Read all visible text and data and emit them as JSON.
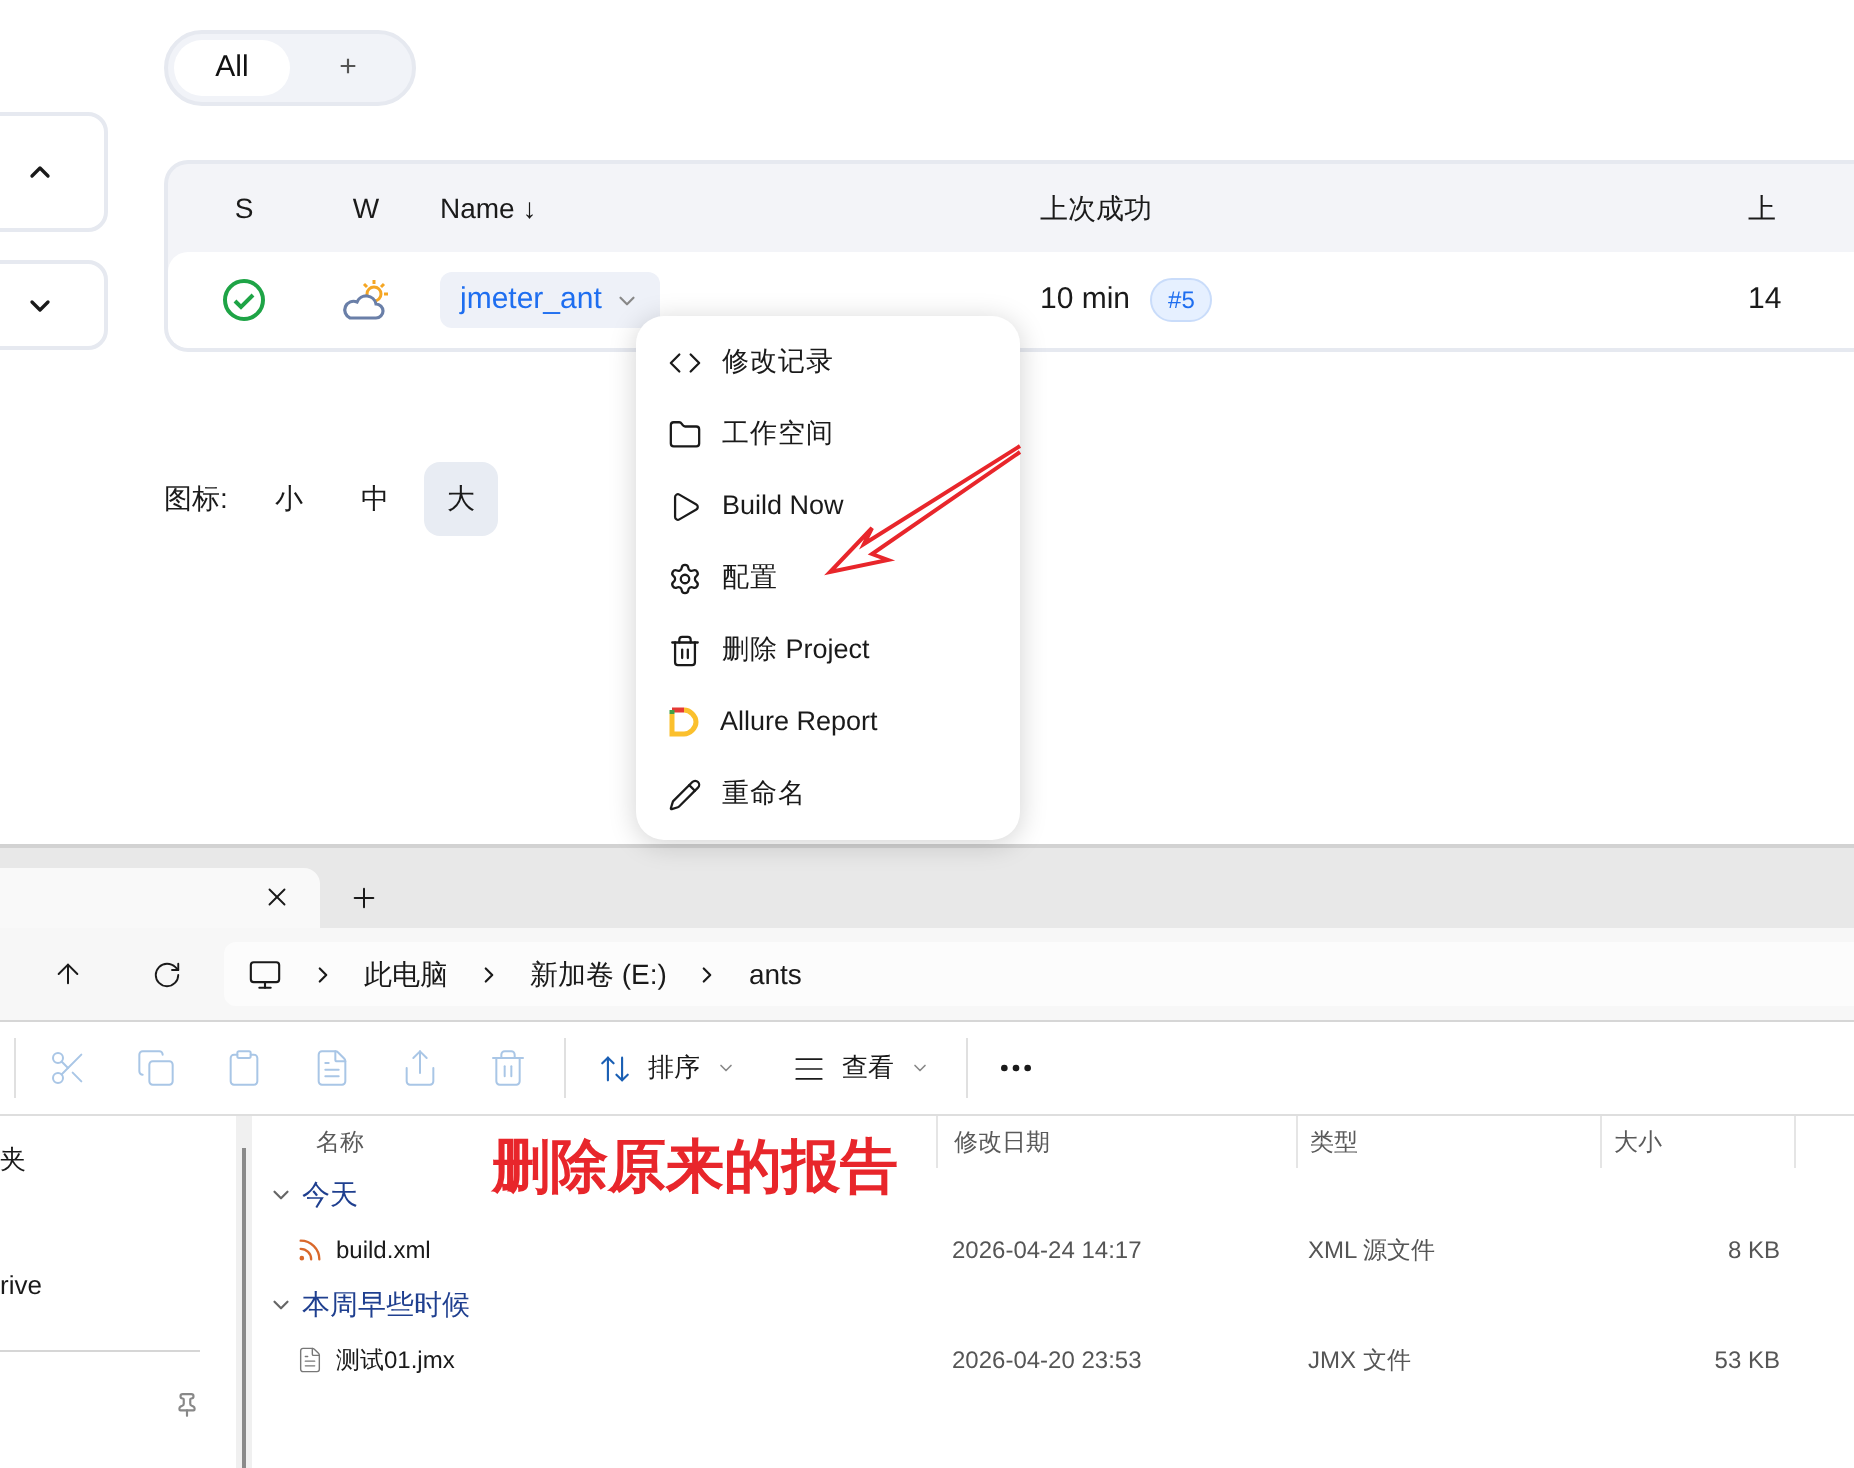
{
  "view_tabs": [
    {
      "label": "All",
      "selected": true
    },
    {
      "label": "+",
      "selected": false
    }
  ],
  "jobs_table": {
    "columns": [
      "S",
      "W",
      "Name ↓",
      "上次成功",
      "上"
    ],
    "rows": [
      {
        "status": {
          "kind": "success"
        },
        "weather": {
          "kind": "cloudsun"
        },
        "name": "jmeter_ant",
        "last_success": "10 min",
        "build": "#5",
        "column_5": "14"
      }
    ]
  },
  "icon_size": {
    "label": "图标:",
    "options": [
      {
        "label": "小",
        "selected": false
      },
      {
        "label": "中",
        "selected": false
      },
      {
        "label": "大",
        "selected": true
      }
    ]
  },
  "job_menu": [
    {
      "kind": "code",
      "label": "修改记录"
    },
    {
      "kind": "folder",
      "label": "工作空间"
    },
    {
      "kind": "play",
      "label": "Build Now"
    },
    {
      "kind": "gear",
      "label": "配置"
    },
    {
      "kind": "trash",
      "label": "删除 Project"
    },
    {
      "kind": "allure",
      "label": "Allure Report"
    },
    {
      "kind": "pencil",
      "label": "重命名"
    }
  ],
  "explorer": {
    "breadcrumb": [
      "此电脑",
      "新加卷 (E:)",
      "ants"
    ],
    "toolbar_actions": [
      {
        "kind": "cut",
        "disabled": true
      },
      {
        "kind": "copy",
        "disabled": true
      },
      {
        "kind": "paste",
        "disabled": true
      },
      {
        "kind": "rename",
        "disabled": true
      },
      {
        "kind": "share",
        "disabled": true
      },
      {
        "kind": "delete",
        "disabled": true
      }
    ],
    "sort_label": "排序",
    "view_label": "查看",
    "sidebar": [
      "夹",
      "rive"
    ],
    "columns": [
      "名称",
      "修改日期",
      "类型",
      "大小"
    ],
    "groups": [
      {
        "label": "今天",
        "expanded": true,
        "files": [
          {
            "kind": "xml",
            "name": "build.xml",
            "modified": "2026-04-24 14:17",
            "type": "XML 源文件",
            "size": "8 KB"
          }
        ]
      },
      {
        "label": "本周早些时候",
        "expanded": true,
        "files": [
          {
            "kind": "plain",
            "name": "测试01.jmx",
            "modified": "2026-04-20 23:53",
            "type": "JMX 文件",
            "size": "53 KB"
          }
        ]
      }
    ]
  },
  "annotation": "删除原来的报告"
}
